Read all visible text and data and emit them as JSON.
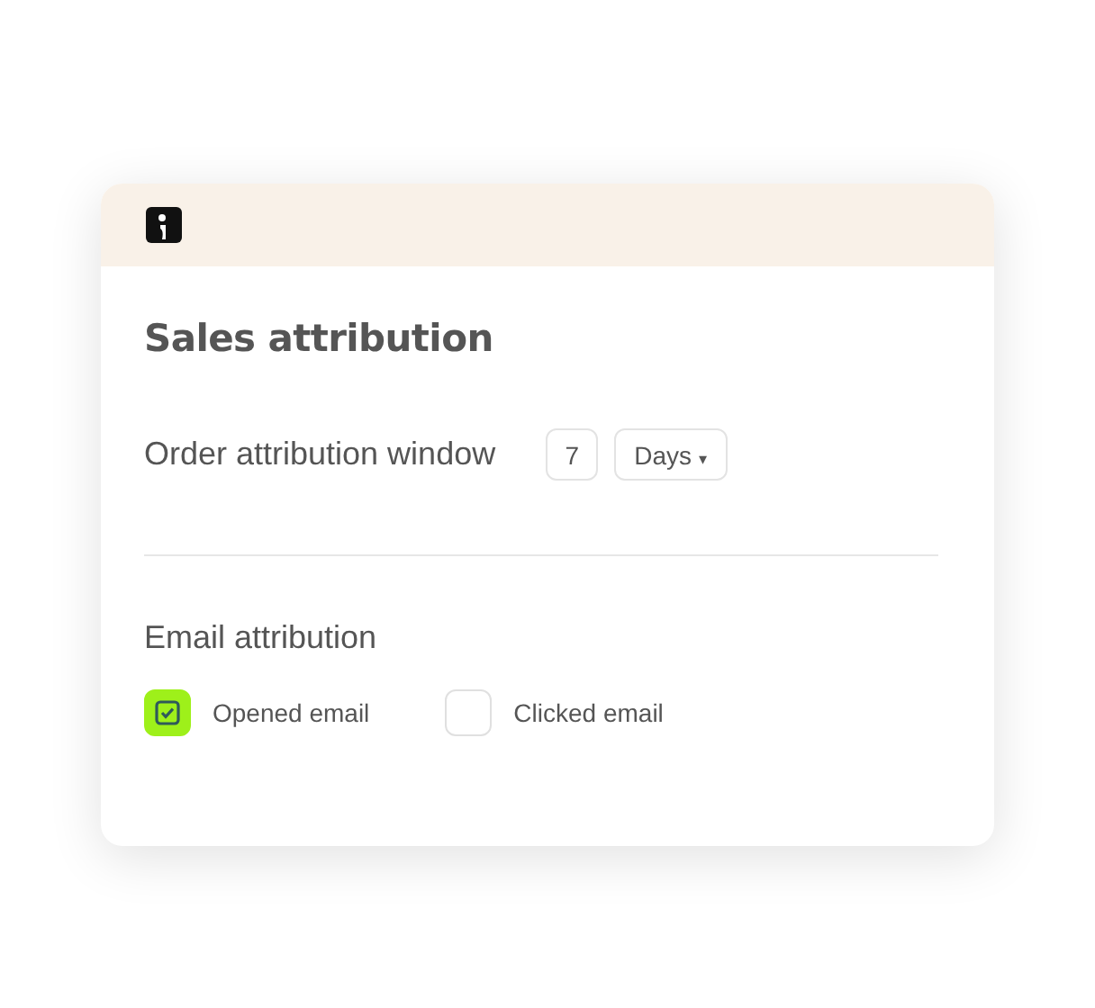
{
  "card": {
    "title": "Sales attribution"
  },
  "order_window": {
    "label": "Order attribution window",
    "value": "7",
    "unit": "Days",
    "caret": "▾"
  },
  "email_attribution": {
    "label": "Email attribution",
    "options": [
      {
        "label": "Opened email",
        "checked": true
      },
      {
        "label": "Clicked email",
        "checked": false
      }
    ]
  }
}
